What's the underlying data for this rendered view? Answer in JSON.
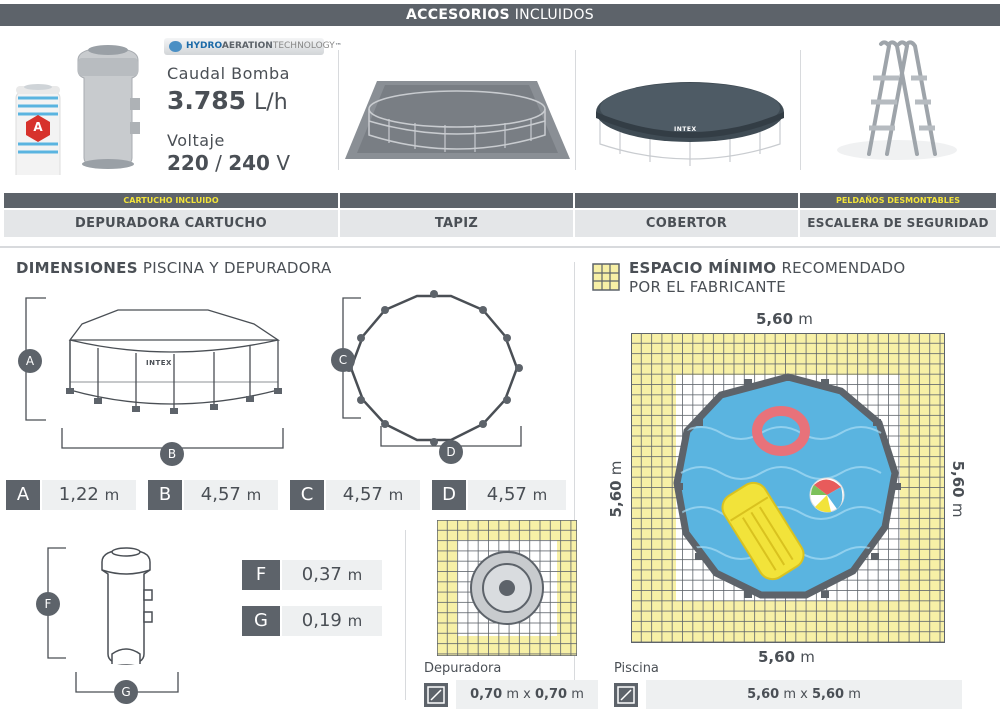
{
  "banner": {
    "bold": "ACCESORIOS",
    "rest": "INCLUIDOS"
  },
  "pump": {
    "tech_word1": "HYDRO",
    "tech_word2": "AERATION",
    "tech_word3": "TECHNOLOGY",
    "tech_mark": "™",
    "cartridge_letter": "A",
    "flow_label": "Caudal Bomba",
    "flow_value": "3.785",
    "flow_unit": "L/h",
    "voltage_label": "Voltaje",
    "voltage_a": "220",
    "voltage_sep": "/",
    "voltage_b": "240",
    "voltage_unit": "V"
  },
  "cover_brand": "INTEX",
  "accessories": [
    {
      "caption": "CARTUCHO INCLUIDO",
      "name": "DEPURADORA CARTUCHO"
    },
    {
      "caption": "",
      "name": "TAPIZ"
    },
    {
      "caption": "",
      "name": "COBERTOR"
    },
    {
      "caption": "PELDAÑOS DESMONTABLES",
      "name": "ESCALERA DE SEGURIDAD"
    }
  ],
  "dimensions": {
    "title_bold": "DIMENSIONES",
    "title_rest": "PISCINA Y DEPURADORA",
    "pool_brand": "INTEX",
    "labels": {
      "A": "A",
      "B": "B",
      "C": "C",
      "D": "D",
      "F": "F",
      "G": "G"
    },
    "values": [
      {
        "letter": "A",
        "value": "1,22",
        "unit": "m"
      },
      {
        "letter": "B",
        "value": "4,57",
        "unit": "m"
      },
      {
        "letter": "C",
        "value": "4,57",
        "unit": "m"
      },
      {
        "letter": "D",
        "value": "4,57",
        "unit": "m"
      }
    ],
    "pump_values": [
      {
        "letter": "F",
        "value": "0,37",
        "unit": "m"
      },
      {
        "letter": "G",
        "value": "0,19",
        "unit": "m"
      }
    ]
  },
  "space": {
    "title_bold": "ESPACIO MÍNIMO",
    "title_rest1": "RECOMENDADO",
    "title_rest2": "POR EL FABRICANTE",
    "top_value": "5,60",
    "top_unit": "m",
    "bottom_value": "5,60",
    "bottom_unit": "m",
    "left_value": "5,60",
    "left_unit": "m",
    "right_value": "5,60",
    "right_unit": "m",
    "depuradora_label": "Depuradora",
    "depuradora_a": "0,70",
    "depuradora_x": "x",
    "depuradora_b": "0,70",
    "depuradora_unit": "m",
    "piscina_label": "Piscina",
    "piscina_a": "5,60",
    "piscina_x": "x",
    "piscina_b": "5,60",
    "piscina_unit": "m"
  },
  "colors": {
    "dark": "#5d636a",
    "yellow": "#f2e33a",
    "light_yellow": "#f7f0a6",
    "water": "#5ab4e0"
  }
}
